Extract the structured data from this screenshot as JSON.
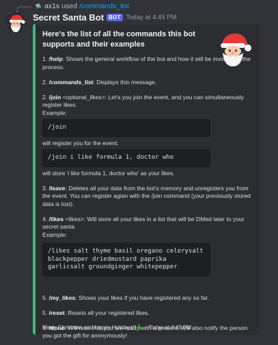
{
  "reply": {
    "username": "ax1s",
    "used_text": "used",
    "command": "/commands_list"
  },
  "message": {
    "username": "Secret Santa Bot",
    "bot_badge": "BOT",
    "timestamp": "Today at 4:45 PM"
  },
  "embed": {
    "accent_color": "#43b581",
    "title": "Here's the list of all the commands this bot supports and their examples",
    "items": {
      "help_num": "1.",
      "help_cmd": "/help",
      "help_desc": ": Shows the general workflow of the bot and how it will be involved in the process.",
      "commands_num": "2.",
      "commands_cmd": "/commands_list",
      "commands_desc": ": Displays this message.",
      "join_num": "2.",
      "join_cmd": "/join",
      "join_arg": " <optional_likes>",
      "join_desc": ": Let's you join the event, and you can simultaneously register likes.",
      "join_example_label": "Example:",
      "join_code1": "/join",
      "join_code1_after": "will register you for the event.",
      "join_code2": "/join i like formula 1, doctor who",
      "join_code2_after": "will store 'i like formula 1, doctor who' as your likes.",
      "leave_num": "3.",
      "leave_cmd": "/leave",
      "leave_desc": ": Deletes all your data from the bot's memory and unregisters you from the event. You can register agian with the /join command (your previously stored data is lost).",
      "likes_num": "4.",
      "likes_cmd": "/likes",
      "likes_arg": " <likes>",
      "likes_desc": ": Will store all your likes in a list that will be DMed later to your secret santa.",
      "likes_example_label": "Example:",
      "likes_code": "/likes salt thyme basil oregano celerysalt blackpepper driedmustard paprika garlicsalt groundginger whitepepper",
      "mylikes_num": "5.",
      "mylikes_cmd": "/my_likes",
      "mylikes_desc": ": Shows your likes if you have registered any so far.",
      "reset_num": "5.",
      "reset_cmd": "/reset",
      "reset_desc": ": Resets all your registered likes.",
      "done_num": "6.",
      "done_cmd": "/done",
      "done_desc": ": Will note that you are ready with a present. Will also notify the person you got the gift for anonymously!"
    },
    "footer": {
      "text": "Merry Christmas and Happy Holidays!!🎄",
      "separator": "•",
      "time": "Today at 4:45 PM"
    }
  },
  "icons": {
    "avatar": "santa-avatar-icon",
    "thumbnail": "santa-thumbnail-icon",
    "reply_avatar": "reply-user-avatar-icon"
  }
}
